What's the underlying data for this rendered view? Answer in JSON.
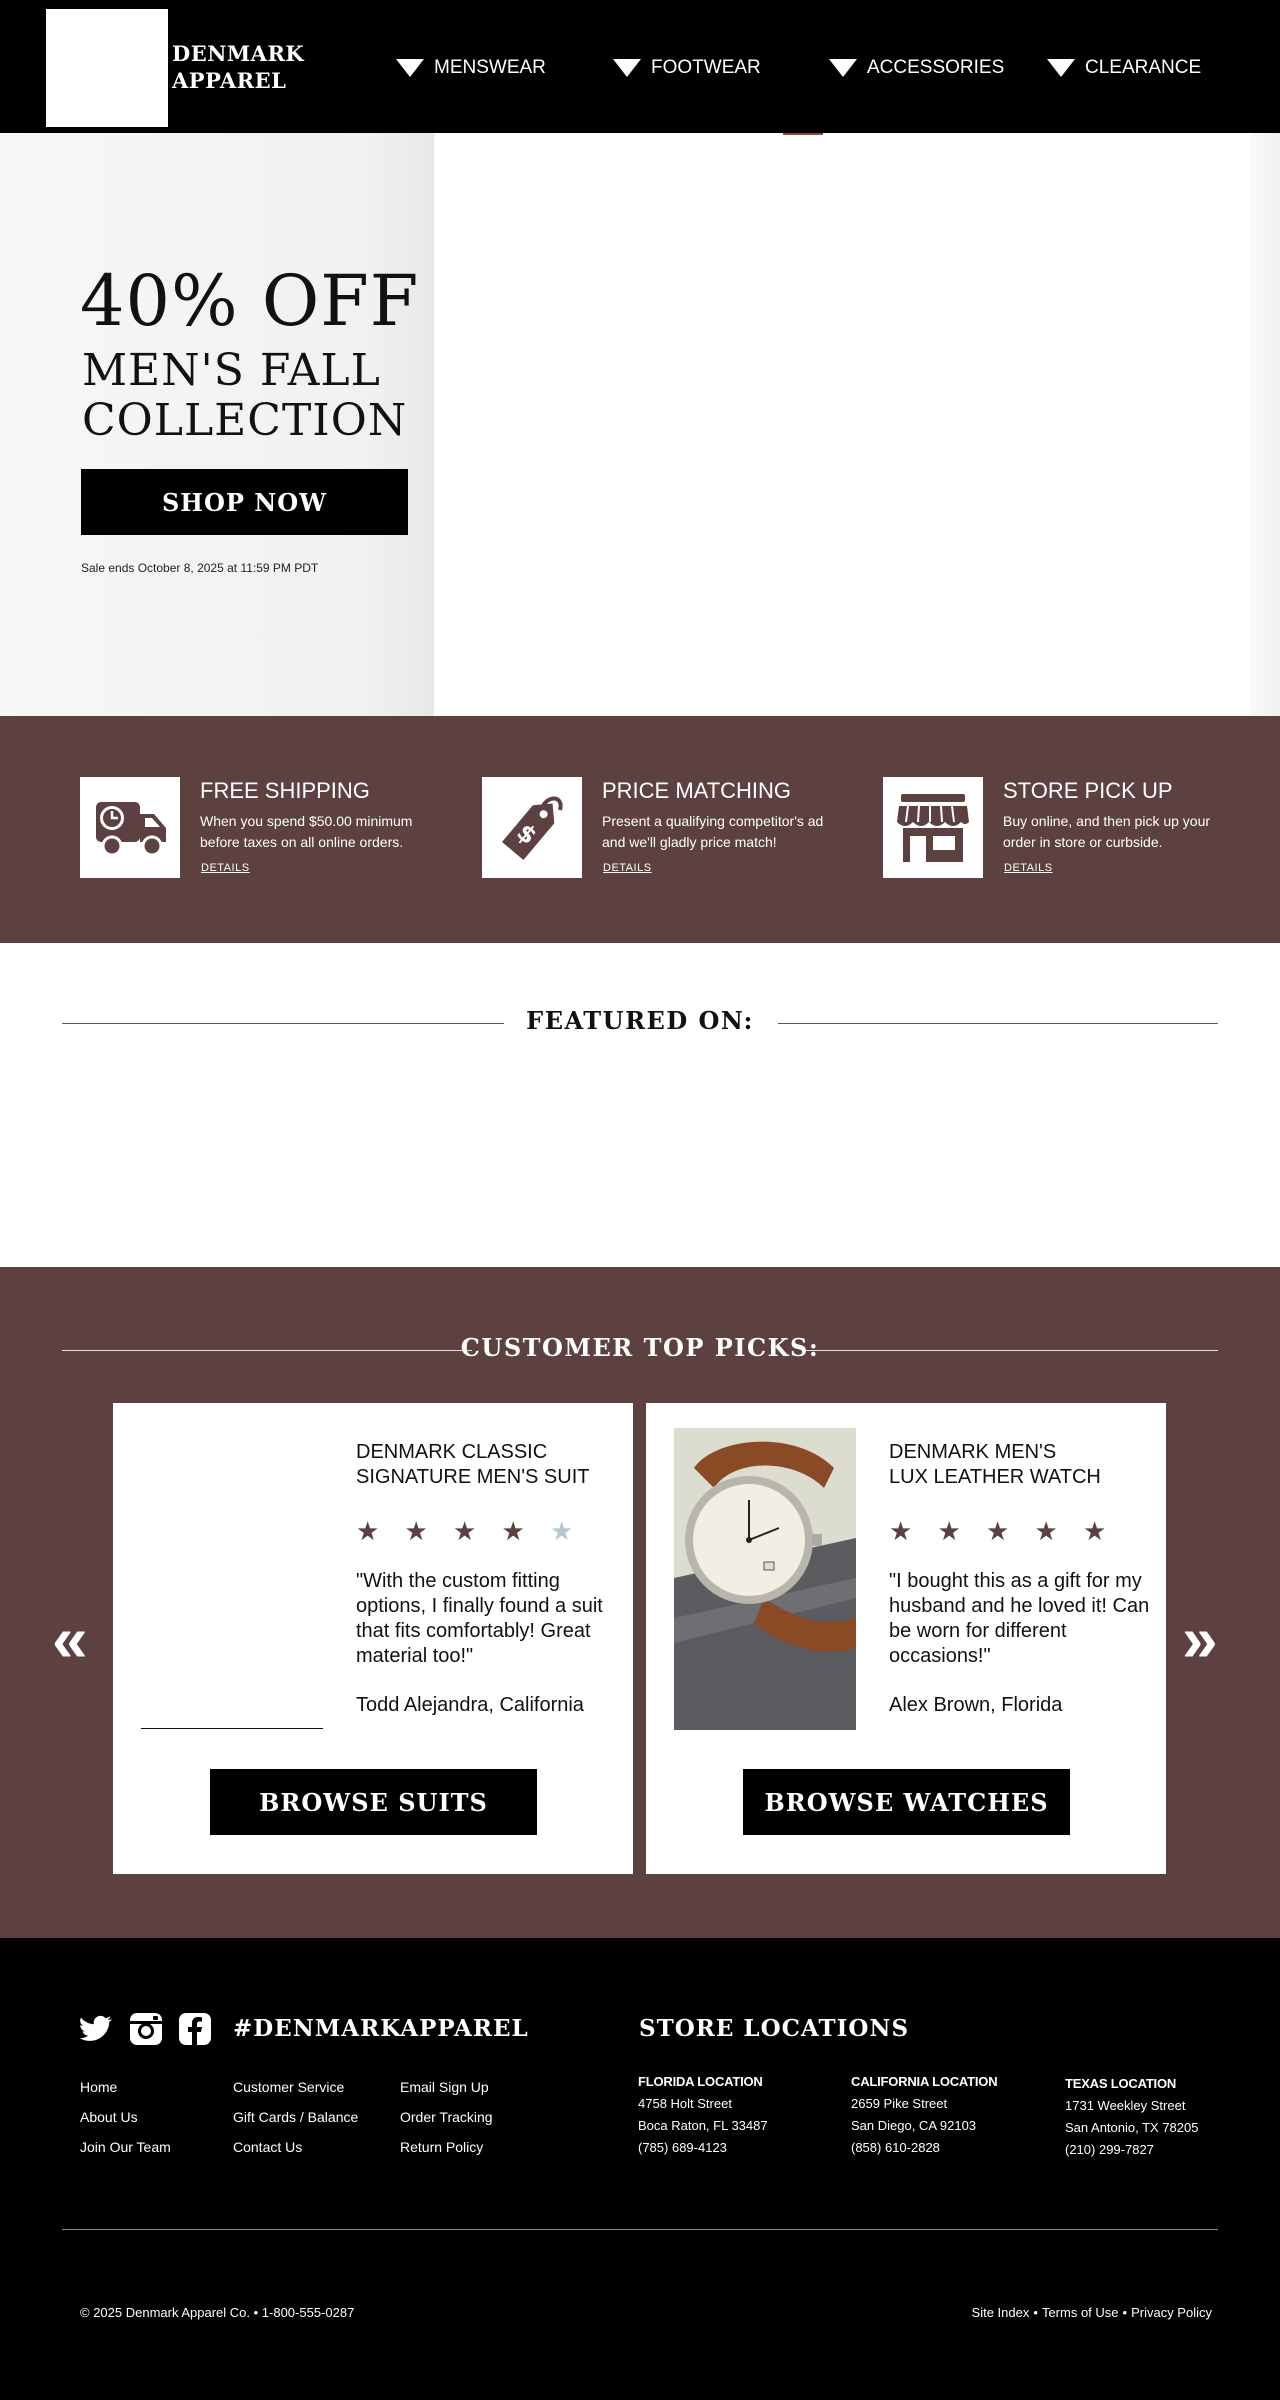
{
  "header": {
    "brand_line1": "DENMARK",
    "brand_line2": "APPAREL",
    "nav": [
      {
        "label": "MENSWEAR"
      },
      {
        "label": "FOOTWEAR"
      },
      {
        "label": "ACCESSORIES"
      },
      {
        "label": "CLEARANCE"
      }
    ]
  },
  "hero": {
    "discount": "40% OFF",
    "line1": "MEN'S FALL",
    "line2": "COLLECTION",
    "button": "SHOP NOW",
    "sale_ends": "Sale ends October 8, 2025 at 11:59 PM PDT"
  },
  "features": [
    {
      "icon": "delivery-truck-icon",
      "title": "FREE SHIPPING",
      "desc": "When you spend $50.00 minimum before taxes on all online orders.",
      "link": "DETAILS"
    },
    {
      "icon": "price-tag-icon",
      "title": "PRICE MATCHING",
      "desc": "Present a qualifying competitor's ad and we'll gladly price match!",
      "link": "DETAILS"
    },
    {
      "icon": "storefront-icon",
      "title": "STORE PICK UP",
      "desc": "Buy online, and then pick up your order in store or curbside.",
      "link": "DETAILS"
    }
  ],
  "featured": {
    "title": "FEATURED ON:"
  },
  "picks": {
    "title": "CUSTOMER TOP PICKS:",
    "prev_icon": "double-chevron-left-icon",
    "next_icon": "double-chevron-right-icon",
    "cards": [
      {
        "title_line1": "DENMARK CLASSIC",
        "title_line2": "SIGNATURE MEN'S SUIT",
        "rating": 4,
        "rating_max": 5,
        "quote": "\"With the custom fitting options, I finally found a suit that fits comfortably! Great material too!\"",
        "reviewer": "Todd Alejandra, California",
        "button": "BROWSE SUITS"
      },
      {
        "title_line1": "DENMARK MEN'S",
        "title_line2": "LUX LEATHER WATCH",
        "rating": 5,
        "rating_max": 5,
        "quote": "\"I bought this as a gift for my husband and he loved it! Can be worn for different occasions!\"",
        "reviewer": "Alex Brown, Florida",
        "button": "BROWSE WATCHES"
      }
    ]
  },
  "footer": {
    "social": [
      {
        "icon": "twitter-icon"
      },
      {
        "icon": "instagram-icon"
      },
      {
        "icon": "facebook-icon"
      }
    ],
    "hashtag": "#DENMARKAPPAREL",
    "links_col1": [
      "Home",
      "About Us",
      "Join Our Team"
    ],
    "links_col2": [
      "Customer Service",
      "Gift Cards / Balance",
      "Contact Us"
    ],
    "links_col3": [
      "Email Sign Up",
      "Order Tracking",
      "Return Policy"
    ],
    "store_heading": "STORE LOCATIONS",
    "locations": [
      {
        "name": "FLORIDA LOCATION",
        "street": "4758 Holt Street",
        "city": "Boca Raton, FL 33487",
        "phone": "(785) 689-4123"
      },
      {
        "name": "CALIFORNIA LOCATION",
        "street": "2659 Pike Street",
        "city": "San Diego, CA 92103",
        "phone": "(858) 610-2828"
      },
      {
        "name": "TEXAS LOCATION",
        "street": "1731 Weekley Street",
        "city": "San Antonio, TX 78205",
        "phone": "(210) 299-7827"
      }
    ],
    "copyright": "© 2025 Denmark Apparel Co. • 1-800-555-0287",
    "legal": {
      "site_index": "Site Index",
      "sep": "•",
      "terms": "Terms of Use",
      "privacy": "Privacy Policy"
    }
  },
  "colors": {
    "brand_brown": "#5c4140",
    "black": "#000000",
    "white": "#ffffff",
    "star_inactive": "#b4c8cc"
  }
}
